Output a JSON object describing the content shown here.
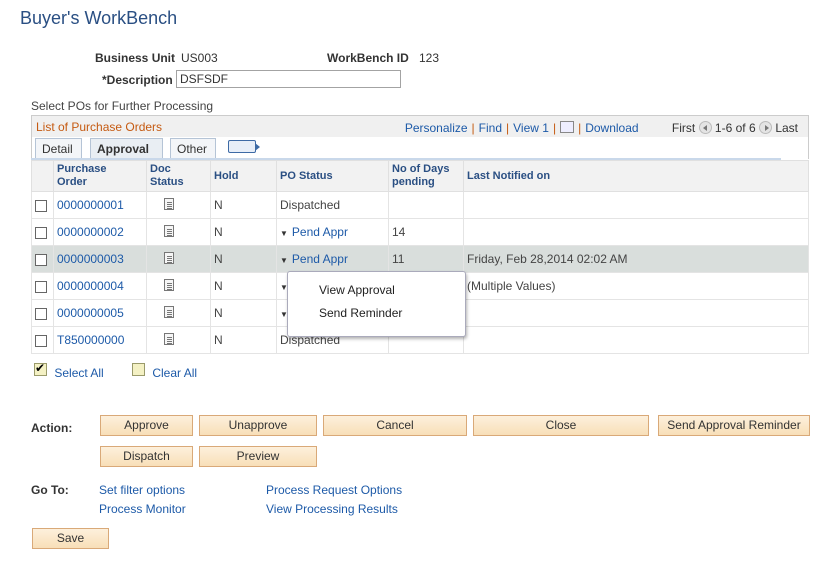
{
  "page": {
    "title": "Buyer's WorkBench"
  },
  "header": {
    "business_unit_label": "Business Unit",
    "business_unit_value": "US003",
    "workbench_id_label": "WorkBench ID",
    "workbench_id_value": "123",
    "description_label": "*Description",
    "description_value": "DSFSDF"
  },
  "section_label": "Select POs for Further Processing",
  "grid": {
    "title": "List of Purchase Orders",
    "nav": {
      "personalize": "Personalize",
      "find": "Find",
      "view": "View 1",
      "download": "Download",
      "first": "First",
      "range": "1-6 of 6",
      "last": "Last"
    },
    "tabs": [
      {
        "label": "Detail",
        "active": false
      },
      {
        "label": "Approval",
        "active": true
      },
      {
        "label": "Other",
        "active": false
      }
    ],
    "columns": [
      "Purchase Order",
      "Doc Status",
      "Hold",
      "PO Status",
      "No of Days pending",
      "Last Notified on"
    ],
    "column_lines": {
      "po_1": "Purchase",
      "po_2": "Order",
      "days_1": "No of Days",
      "days_2": "pending"
    },
    "rows": [
      {
        "po": "0000000001",
        "hold": "N",
        "status": "Dispatched",
        "status_link": false,
        "days": "",
        "notified": ""
      },
      {
        "po": "0000000002",
        "hold": "N",
        "status": "Pend Appr",
        "status_link": true,
        "days": "14",
        "notified": ""
      },
      {
        "po": "0000000003",
        "hold": "N",
        "status": "Pend Appr",
        "status_link": true,
        "days": "11",
        "notified": "Friday, Feb 28,2014 02:02 AM"
      },
      {
        "po": "0000000004",
        "hold": "N",
        "status": "",
        "status_link": true,
        "days": "",
        "notified": "(Multiple Values)"
      },
      {
        "po": "0000000005",
        "hold": "N",
        "status": "",
        "status_link": true,
        "days": "",
        "notified": ""
      },
      {
        "po": "T850000000",
        "hold": "N",
        "status": "Dispatched",
        "status_link": false,
        "days": "",
        "notified": ""
      }
    ]
  },
  "popup_menu": {
    "items": [
      "View Approval",
      "Send Reminder"
    ]
  },
  "selection": {
    "select_all": "Select All",
    "clear_all": "Clear All"
  },
  "actions": {
    "label": "Action:",
    "buttons": [
      "Approve",
      "Unapprove",
      "Cancel",
      "Close",
      "Send Approval Reminder",
      "Dispatch",
      "Preview"
    ]
  },
  "goto": {
    "label": "Go To:",
    "links": [
      "Set filter options",
      "Process Request Options",
      "Process Monitor",
      "View Processing Results"
    ]
  },
  "save_label": "Save"
}
